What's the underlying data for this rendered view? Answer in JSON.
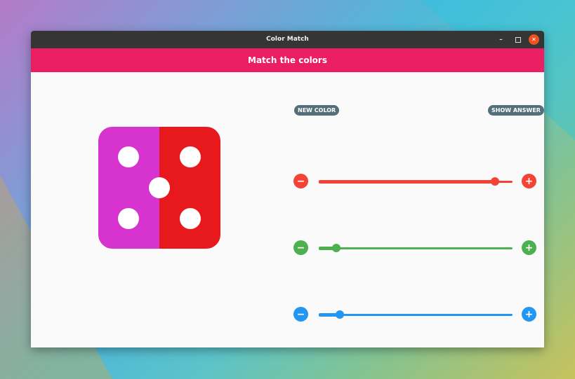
{
  "window": {
    "title": "Color Match"
  },
  "appbar": {
    "title": "Match the colors"
  },
  "die": {
    "left_color": "#d633cf",
    "right_color": "#e8191d"
  },
  "buttons": {
    "new_color": "NEW COLOR",
    "show_answer": "SHOW ANSWER"
  },
  "sliders": [
    {
      "name": "red",
      "color": "#f44336",
      "value": 0.91
    },
    {
      "name": "green",
      "color": "#4caf50",
      "value": 0.09
    },
    {
      "name": "blue",
      "color": "#2196f3",
      "value": 0.11
    }
  ],
  "icons": {
    "minus": "−",
    "plus": "+"
  }
}
